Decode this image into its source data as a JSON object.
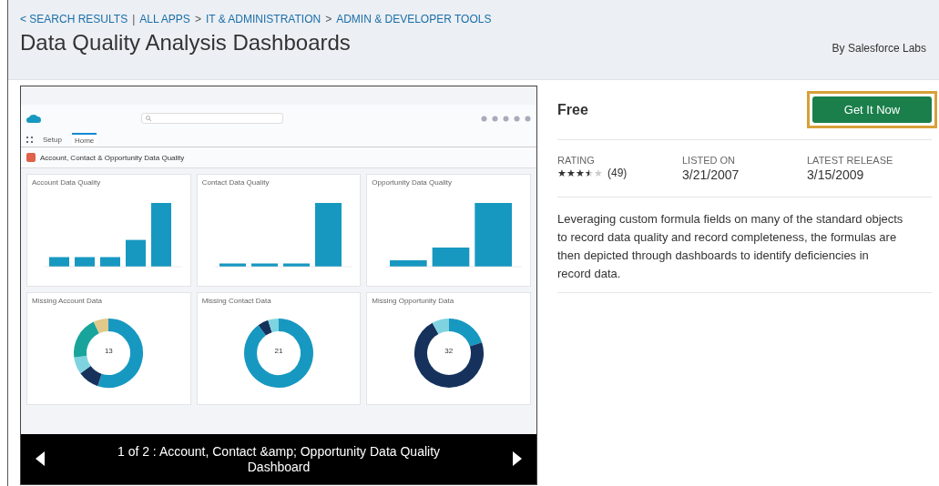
{
  "breadcrumb": [
    {
      "kind": "link",
      "label": "< SEARCH RESULTS"
    },
    {
      "kind": "separator",
      "label": "|"
    },
    {
      "kind": "link",
      "label": "ALL APPS"
    },
    {
      "kind": "separator",
      "label": ">"
    },
    {
      "kind": "link",
      "label": "IT & ADMINISTRATION"
    },
    {
      "kind": "separator",
      "label": ">"
    },
    {
      "kind": "link",
      "label": "ADMIN & DEVELOPER TOOLS"
    }
  ],
  "title": "Data Quality Analysis Dashboards",
  "publisher": "By Salesforce Labs",
  "gallery": {
    "screenshot": {
      "app_tabs": [
        {
          "label": "Setup",
          "selected": false
        },
        {
          "label": "Home",
          "selected": true
        }
      ],
      "dashboard_title": "Account, Contact & Opportunity Data Quality",
      "panels": [
        {
          "kind": "bar",
          "title": "Account Data Quality"
        },
        {
          "kind": "bar",
          "title": "Contact Data Quality"
        },
        {
          "kind": "bar",
          "title": "Opportunity Data Quality"
        },
        {
          "kind": "donut",
          "title": "Missing Account Data",
          "center": "13"
        },
        {
          "kind": "donut",
          "title": "Missing Contact Data",
          "center": "21"
        },
        {
          "kind": "donut",
          "title": "Missing Opportunity Data",
          "center": "32"
        }
      ]
    },
    "caption": "1 of 2 : Account, Contact &amp; Opportunity Data Quality Dashboard"
  },
  "price": "Free",
  "action": {
    "label": "Get It Now",
    "focused": true
  },
  "stats": [
    {
      "kind": "rating",
      "label": "RATING",
      "stars": 3.5,
      "value": "(49)"
    },
    {
      "kind": "date",
      "label": "LISTED ON",
      "value": "3/21/2007"
    },
    {
      "kind": "date",
      "label": "LATEST RELEASE",
      "value": "3/15/2009"
    }
  ],
  "description": "Leveraging custom formula fields on many of the standard objects to record data quality and record completeness, the formulas are then depicted through dashboards to identify deficiencies in record data."
}
